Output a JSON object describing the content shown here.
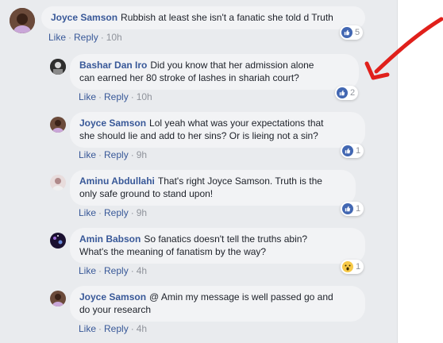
{
  "comments": [
    {
      "author": "Joyce Samson",
      "text": "Rubbish at least she isn't a fanatic she told d Truth",
      "like": "Like",
      "reply": "Reply",
      "time": "10h",
      "reaction_count": "5"
    },
    {
      "author": "Bashar Dan Iro",
      "text_line1": "Did you know that her admission alone",
      "text_line2": "can earned her 80 stroke of lashes in shariah court?",
      "like": "Like",
      "reply": "Reply",
      "time": "10h",
      "reaction_count": "2"
    },
    {
      "author": "Joyce Samson",
      "text_line1": "Lol yeah what was your expectations that",
      "text_line2": "she should lie and add to her sins? Or is lieing not a sin?",
      "like": "Like",
      "reply": "Reply",
      "time": "9h",
      "reaction_count": "1"
    },
    {
      "author": "Aminu Abdullahi",
      "text_line1": "That's right Joyce Samson. Truth is the",
      "text_line2": "only safe ground to stand upon!",
      "like": "Like",
      "reply": "Reply",
      "time": "9h",
      "reaction_count": "1"
    },
    {
      "author": "Amin Babson",
      "text_line1": "So fanatics doesn't tell the truths abin?",
      "text_line2": "What's the meaning of fanatism by the way?",
      "like": "Like",
      "reply": "Reply",
      "time": "4h",
      "reaction_count": "1"
    },
    {
      "author": "Joyce Samson",
      "text_line1": "@ Amin my message is well passed go and",
      "text_line2": "do your research",
      "like": "Like",
      "reply": "Reply",
      "time": "4h"
    }
  ],
  "colors": {
    "author": "#385898",
    "link": "#385898",
    "meta": "#90949c",
    "bubble": "#f2f3f5",
    "like_blue": "#4267b2",
    "annotation_arrow": "#e0201b"
  }
}
